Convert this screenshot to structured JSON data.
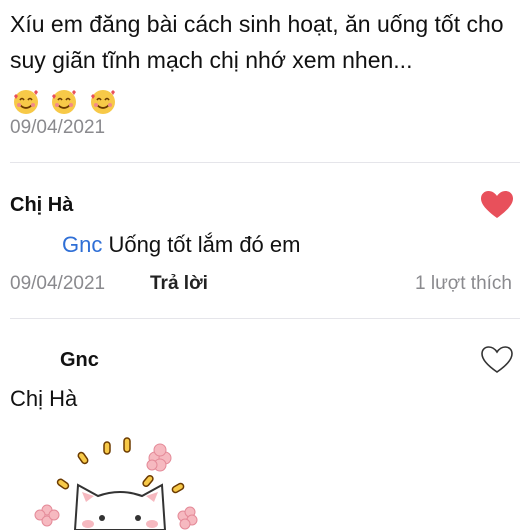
{
  "top_comment": {
    "text": "Xíu em đăng bài cách sinh hoạt, ăn uống tốt cho suy giãn tĩnh mạch chị nhớ xem nhen...",
    "emoji_icons": [
      "smiling-face-with-hearts-icon",
      "smiling-face-with-hearts-icon",
      "smiling-face-with-hearts-icon"
    ],
    "date": "09/04/2021"
  },
  "reply_1": {
    "author": "Chị Hà",
    "mention": "Gnc",
    "text": "Uống tốt lắm đó em",
    "date": "09/04/2021",
    "reply_label": "Trả lời",
    "likes_label": "1 lượt thích",
    "heart_icon": "heart-filled-icon",
    "heart_color": "#e8505b"
  },
  "reply_2": {
    "author": "Gnc",
    "mention": "Chị Hà",
    "heart_icon": "heart-outline-icon",
    "sticker_icon": "cat-sticker-icon"
  },
  "colors": {
    "mention": "#2f6fd6",
    "secondary_text": "#8a8a8e",
    "divider": "#e5e5ea"
  }
}
